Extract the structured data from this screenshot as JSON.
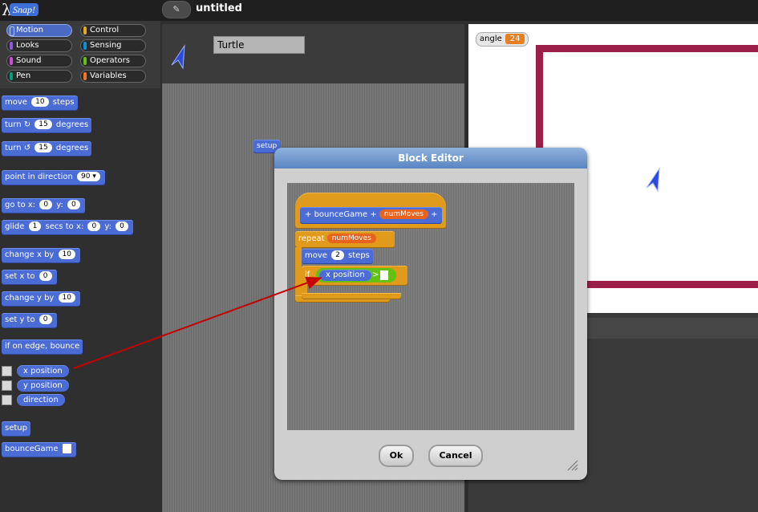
{
  "app": {
    "logo_text": "Snap!",
    "logo_glyph": "λ",
    "project_title": "untitled",
    "edit_icon": "pencil-icon"
  },
  "categories": [
    {
      "label": "Motion",
      "color": "#4a6cd4",
      "active": true
    },
    {
      "label": "Control",
      "color": "#e6a822"
    },
    {
      "label": "Looks",
      "color": "#8f56e3"
    },
    {
      "label": "Sensing",
      "color": "#0494dc"
    },
    {
      "label": "Sound",
      "color": "#cf4ad9"
    },
    {
      "label": "Operators",
      "color": "#62c213"
    },
    {
      "label": "Pen",
      "color": "#00a178"
    },
    {
      "label": "Variables",
      "color": "#f3761d"
    }
  ],
  "palette": {
    "move": {
      "pre": "move",
      "val": "10",
      "post": "steps"
    },
    "turn_right": {
      "pre": "turn ↻",
      "val": "15",
      "post": "degrees"
    },
    "turn_left": {
      "pre": "turn ↺",
      "val": "15",
      "post": "degrees"
    },
    "point_dir": {
      "pre": "point in direction",
      "val": "90 ▾"
    },
    "goto": {
      "pre": "go to x:",
      "x": "0",
      "mid": "y:",
      "y": "0"
    },
    "glide": {
      "pre": "glide",
      "secs": "1",
      "mid1": "secs to x:",
      "x": "0",
      "mid2": "y:",
      "y": "0"
    },
    "change_x": {
      "pre": "change x by",
      "val": "10"
    },
    "set_x": {
      "pre": "set x to",
      "val": "0"
    },
    "change_y": {
      "pre": "change y by",
      "val": "10"
    },
    "set_y": {
      "pre": "set y to",
      "val": "0"
    },
    "bounce": "if on edge, bounce",
    "reporters": [
      "x position",
      "y position",
      "direction"
    ],
    "custom": {
      "setup": "setup",
      "bounce_game": "bounceGame"
    }
  },
  "sprite": {
    "name": "Turtle",
    "script_block": "setup"
  },
  "stage": {
    "watcher_label": "angle",
    "watcher_value": "24",
    "border_color": "#9c1f4a"
  },
  "dialog": {
    "title": "Block Editor",
    "hat": {
      "block_name": "bounceGame",
      "param": "numMoves",
      "plus": "+"
    },
    "repeat": {
      "label": "repeat",
      "var": "numMoves"
    },
    "move": {
      "pre": "move",
      "val": "2",
      "post": "steps"
    },
    "if": {
      "label": "if",
      "reporter": "x position",
      "op": ">"
    },
    "ok": "Ok",
    "cancel": "Cancel"
  }
}
